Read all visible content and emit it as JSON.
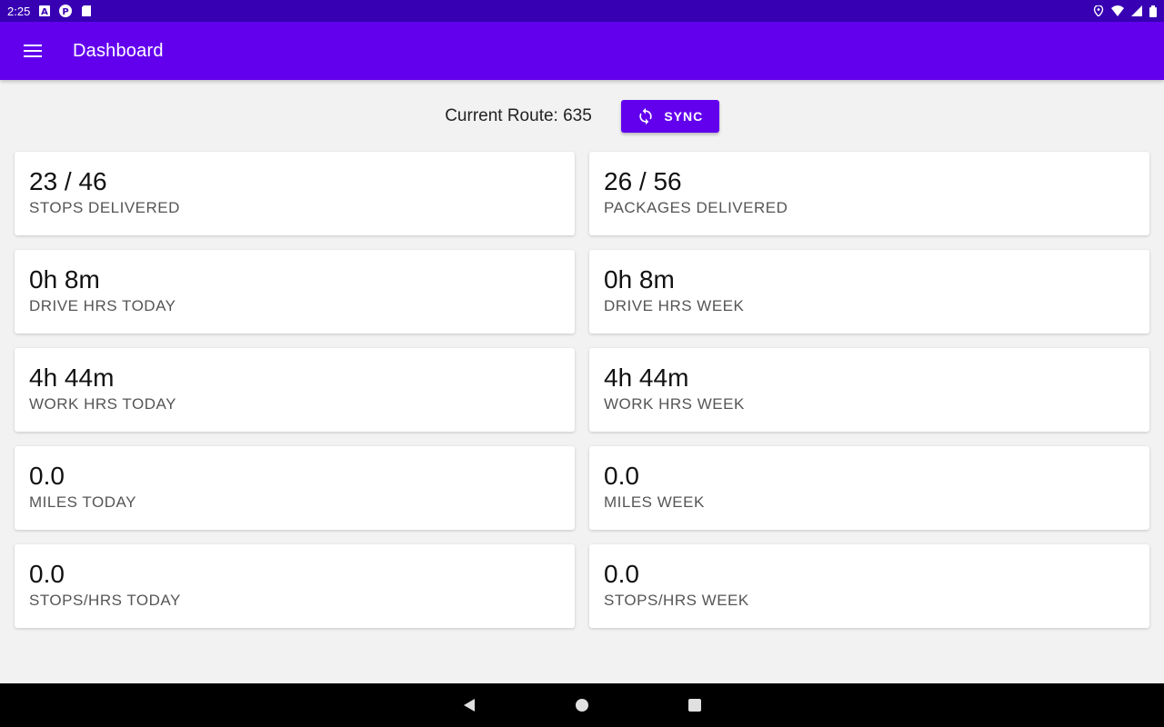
{
  "status_bar": {
    "time": "2:25",
    "icons": [
      "a-notification-icon",
      "p-notification-icon",
      "sd-card-icon",
      "location-icon",
      "wifi-icon",
      "signal-icon",
      "battery-icon"
    ]
  },
  "app_bar": {
    "title": "Dashboard",
    "menu_icon": "hamburger-menu-icon"
  },
  "route": {
    "text": "Current Route: 635",
    "sync_label": "SYNC",
    "sync_icon": "sync-icon"
  },
  "cards": [
    {
      "value": "23 / 46",
      "label": "STOPS DELIVERED"
    },
    {
      "value": "26 / 56",
      "label": "PACKAGES DELIVERED"
    },
    {
      "value": "0h 8m",
      "label": "DRIVE HRS TODAY"
    },
    {
      "value": "0h 8m",
      "label": "DRIVE HRS WEEK"
    },
    {
      "value": "4h 44m",
      "label": "WORK HRS TODAY"
    },
    {
      "value": "4h 44m",
      "label": "WORK HRS WEEK"
    },
    {
      "value": "0.0",
      "label": "MILES TODAY"
    },
    {
      "value": "0.0",
      "label": "MILES WEEK"
    },
    {
      "value": "0.0",
      "label": "STOPS/HRS TODAY"
    },
    {
      "value": "0.0",
      "label": "STOPS/HRS WEEK"
    }
  ],
  "nav_bar": {
    "buttons": [
      "back-icon",
      "home-icon",
      "recents-icon"
    ]
  },
  "colors": {
    "primary": "#6200ee",
    "primary_dark": "#3700b3",
    "background": "#f2f2f2"
  }
}
